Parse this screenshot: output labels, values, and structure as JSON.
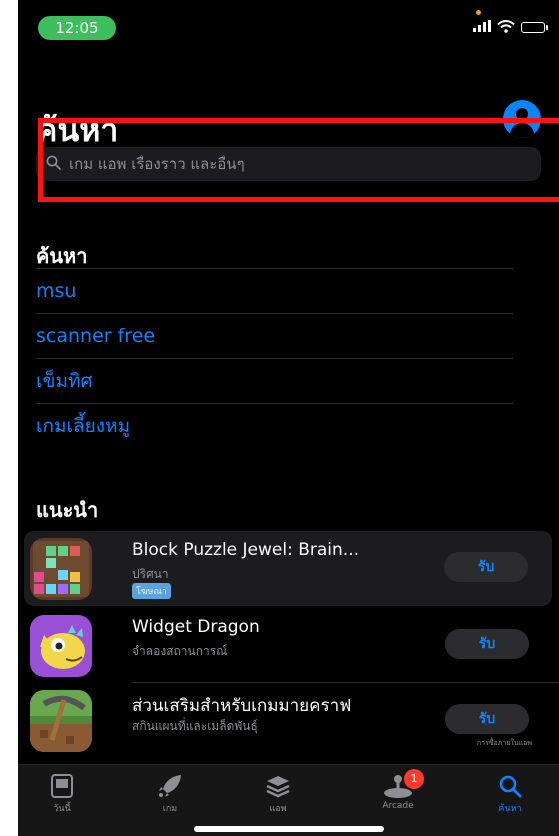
{
  "status_bar": {
    "time": "12:05"
  },
  "header": {
    "title": "ค้นหา"
  },
  "search": {
    "placeholder": "เกม แอพ เรื่องราว และอื่นๆ"
  },
  "recent": {
    "title": "ค้นหา",
    "items": [
      "msu",
      "scanner free",
      "เข็มทิศ",
      "เกมเลี้ยงหมู"
    ]
  },
  "suggested": {
    "title": "แนะนำ",
    "apps": [
      {
        "name": "Block Puzzle Jewel: Brain...",
        "subtitle": "ปริศนา",
        "badge": "โฆษณา",
        "get_label": "รับ",
        "iap": ""
      },
      {
        "name": "Widget Dragon",
        "subtitle": "จำลองสถานการณ์",
        "get_label": "รับ",
        "iap": ""
      },
      {
        "name": "ส่วนเสริมสำหรับเกมมายคราฟ",
        "subtitle": "สกินแผนที่และเมล็ดพันธุ์",
        "get_label": "รับ",
        "iap": "การซื้อภายในแอพ"
      }
    ]
  },
  "tabs": [
    {
      "label": "วันนี้",
      "icon": "today-icon"
    },
    {
      "label": "เกม",
      "icon": "rocket-icon"
    },
    {
      "label": "แอพ",
      "icon": "apps-stack-icon"
    },
    {
      "label": "Arcade",
      "icon": "joystick-icon",
      "badge": "1"
    },
    {
      "label": "ค้นหา",
      "icon": "search-icon"
    }
  ],
  "colors": {
    "accent": "#0a84ff",
    "background": "#000000",
    "highlight": "#ff1212",
    "time_pill": "#3dbf5d"
  }
}
